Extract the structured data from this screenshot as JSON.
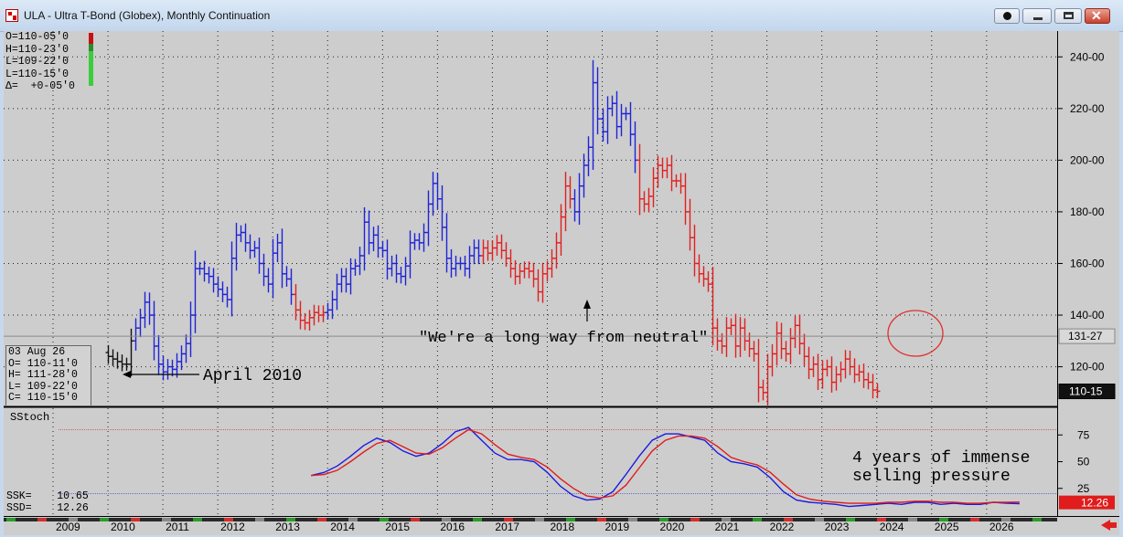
{
  "window": {
    "title": "ULA - Ultra T-Bond (Globex), Monthly Continuation",
    "close_glyph": "✕"
  },
  "header_readout": {
    "open": "O=110-05'0",
    "high": "H=110-23'0",
    "low": "L=109-22'0",
    "last": "L=110-15'0",
    "change": "Δ=  +0-05'0"
  },
  "cursor_readout": {
    "date": "03 Aug 26",
    "open": "O= 110-11'0",
    "high": "H= 111-28'0",
    "low": "L= 109-22'0",
    "close": "C= 110-15'0"
  },
  "stoch_readout": {
    "ssk": "SSK=    10.65",
    "ssd": "SSD=    12.26"
  },
  "colors": {
    "up_trend": "#1f23d6",
    "down_trend": "#e02020",
    "neutral": "#111111",
    "panel_bg": "#cdcdcd",
    "stoch_k": "#1a1ae0",
    "stoch_d": "#e01c1c"
  },
  "chart_data": [
    {
      "type": "ohlc",
      "y_range": [
        105,
        250
      ],
      "y_ticks": [
        "120-00",
        "140-00",
        "160-00",
        "180-00",
        "200-00",
        "220-00",
        "240-00"
      ],
      "y_tick_values": [
        120,
        140,
        160,
        180,
        200,
        220,
        240
      ],
      "x_tick_labels": [
        "2009",
        "2010",
        "2011",
        "2012",
        "2013",
        "2014",
        "2015",
        "2016",
        "2017",
        "2018",
        "2019",
        "2020",
        "2021",
        "2022",
        "2023",
        "2024",
        "2025",
        "2026"
      ],
      "x_tick_years": [
        2009,
        2010,
        2011,
        2012,
        2013,
        2014,
        2015,
        2016,
        2017,
        2018,
        2019,
        2020,
        2021,
        2022,
        2023,
        2024,
        2025,
        2026
      ],
      "price_markers": [
        {
          "label": "131-27",
          "value": 131.84,
          "style": "gray"
        },
        {
          "label": "110-15",
          "value": 110.47,
          "style": "dark"
        }
      ],
      "closes_monthly_from_2010_01": [
        124,
        123,
        122,
        121,
        121,
        130,
        135,
        139,
        145,
        140,
        128,
        121,
        118,
        120,
        119,
        122,
        125,
        129,
        140,
        158,
        158,
        156,
        155,
        152,
        150,
        148,
        146,
        162,
        171,
        172,
        168,
        165,
        166,
        160,
        155,
        152,
        164,
        168,
        156,
        154,
        148,
        142,
        138,
        137,
        139,
        141,
        140,
        141,
        142,
        146,
        152,
        155,
        152,
        158,
        159,
        163,
        176,
        168,
        171,
        166,
        165,
        158,
        160,
        156,
        155,
        159,
        168,
        169,
        168,
        172,
        183,
        191,
        185,
        174,
        162,
        158,
        160,
        160,
        158,
        163,
        166,
        163,
        166,
        164,
        166,
        168,
        165,
        162,
        158,
        155,
        157,
        158,
        157,
        154,
        149,
        156,
        158,
        162,
        168,
        178,
        190,
        185,
        180,
        190,
        198,
        205,
        230,
        216,
        211,
        220,
        222,
        213,
        218,
        218,
        210,
        200,
        185,
        183,
        186,
        193,
        198,
        196,
        198,
        192,
        192,
        190,
        180,
        170,
        160,
        156,
        154,
        152,
        135,
        130,
        128,
        135,
        136,
        128,
        135,
        130,
        127,
        125,
        112,
        110,
        120,
        125,
        133,
        127,
        125,
        131,
        136,
        129,
        124,
        119,
        121,
        115,
        119,
        120,
        114,
        117,
        119,
        123,
        120,
        117,
        118,
        115,
        114,
        111,
        110.5
      ],
      "annotations": [
        {
          "text": "April 2010"
        },
        {
          "text": "\"We're a long way from neutral\""
        }
      ]
    },
    {
      "type": "line",
      "title": "SStoch",
      "y_range": [
        0,
        100
      ],
      "y_ticks": [
        25,
        50,
        75
      ],
      "reference_levels": [
        20,
        80
      ],
      "series": [
        {
          "name": "SSK",
          "start_year": 2013.7,
          "end_year": 2026.6,
          "values": [
            37,
            40,
            46,
            55,
            65,
            72,
            68,
            60,
            55,
            58,
            67,
            78,
            82,
            70,
            58,
            52,
            52,
            50,
            40,
            27,
            18,
            14,
            15,
            22,
            38,
            55,
            70,
            76,
            76,
            73,
            70,
            58,
            50,
            48,
            45,
            35,
            22,
            14,
            12,
            11,
            10,
            8,
            9,
            10,
            11,
            10,
            12,
            12,
            10,
            11,
            10,
            10,
            12,
            11,
            10.65
          ]
        },
        {
          "name": "SSD",
          "start_year": 2013.7,
          "end_year": 2026.6,
          "values": [
            37,
            38,
            42,
            50,
            59,
            67,
            70,
            64,
            58,
            57,
            63,
            72,
            80,
            76,
            66,
            57,
            54,
            52,
            45,
            34,
            25,
            18,
            16,
            18,
            28,
            44,
            60,
            70,
            74,
            74,
            72,
            64,
            54,
            50,
            47,
            40,
            29,
            19,
            15,
            13,
            12,
            11,
            11,
            11,
            12,
            12,
            13,
            13,
            12,
            12,
            11,
            11,
            12,
            12,
            12.26
          ]
        }
      ],
      "value_marker": {
        "label": "12.26",
        "value": 12.26
      }
    }
  ],
  "stoch_annotation": {
    "line1": "4 years of immense",
    "line2": "selling pressure"
  }
}
